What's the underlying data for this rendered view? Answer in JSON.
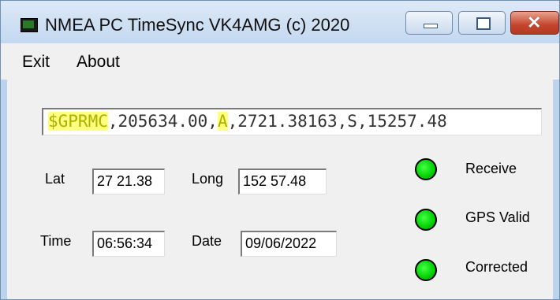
{
  "window": {
    "title": "NMEA PC TimeSync   VK4AMG (c) 2020",
    "controls": {
      "minimize": "–",
      "maximize": "□",
      "close": "✕"
    }
  },
  "menu": {
    "exit": "Exit",
    "about": "About"
  },
  "nmea": {
    "sentence_prefix": "$GPRMC",
    "sentence_mid1": ",205634.00,",
    "sentence_status": "A",
    "sentence_rest": ",2721.38163,S,15257.48"
  },
  "fields": {
    "lat_label": "Lat",
    "lat_value": "27 21.38",
    "long_label": "Long",
    "long_value": "152 57.48",
    "time_label": "Time",
    "time_value": "06:56:34",
    "date_label": "Date",
    "date_value": "09/06/2022"
  },
  "indicators": [
    {
      "label": "Receive",
      "color": "#00d000"
    },
    {
      "label": "GPS Valid",
      "color": "#00d000"
    },
    {
      "label": "Corrected",
      "color": "#00d000"
    }
  ]
}
